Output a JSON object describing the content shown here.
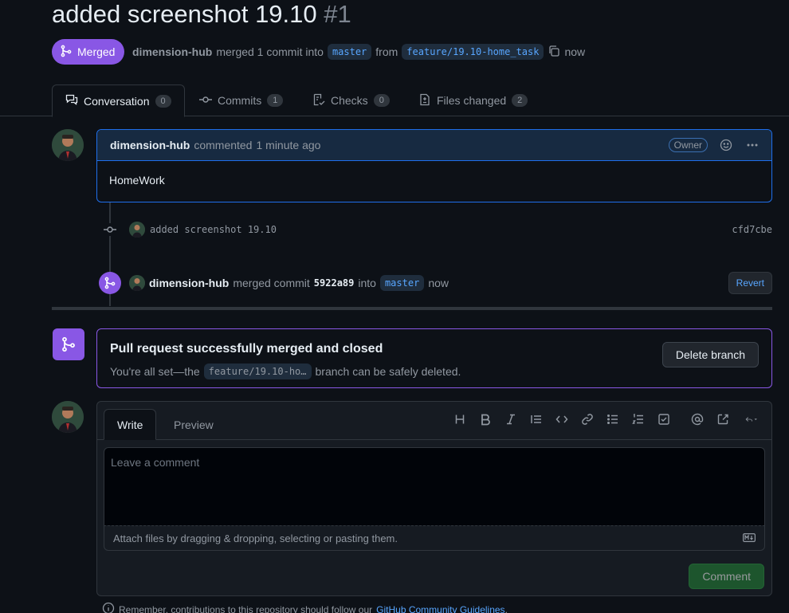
{
  "pr": {
    "title": "added screenshot 19.10",
    "number": "#1",
    "state_label": "Merged",
    "author": "dimension-hub",
    "merged_text": "merged 1 commit into",
    "base_branch": "master",
    "from_text": "from",
    "head_branch": "feature/19.10-home_task",
    "time": "now"
  },
  "tabs": [
    {
      "label": "Conversation",
      "count": "0",
      "icon": "comment-discussion-icon"
    },
    {
      "label": "Commits",
      "count": "1",
      "icon": "git-commit-icon"
    },
    {
      "label": "Checks",
      "count": "0",
      "icon": "checklist-icon"
    },
    {
      "label": "Files changed",
      "count": "2",
      "icon": "file-diff-icon"
    }
  ],
  "comment": {
    "author": "dimension-hub",
    "action": "commented",
    "time": "1 minute ago",
    "role": "Owner",
    "body": "HomeWork"
  },
  "commit": {
    "message": "added screenshot 19.10",
    "sha": "cfd7cbe"
  },
  "merge_event": {
    "author": "dimension-hub",
    "action": "merged commit",
    "sha": "5922a89",
    "into": "into",
    "branch": "master",
    "time": "now",
    "revert_label": "Revert"
  },
  "merged_box": {
    "title": "Pull request successfully merged and closed",
    "sub_pre": "You're all set—the",
    "branch": "feature/19.10-ho…",
    "sub_post": "branch can be safely deleted.",
    "delete_label": "Delete branch"
  },
  "editor": {
    "tab_write": "Write",
    "tab_preview": "Preview",
    "placeholder": "Leave a comment",
    "attach_text": "Attach files by dragging & dropping, selecting or pasting them.",
    "submit_label": "Comment"
  },
  "footer": {
    "text": "Remember, contributions to this repository should follow our",
    "link": "GitHub Community Guidelines",
    "period": "."
  },
  "colors": {
    "merged_purple": "#8957e5",
    "accent_blue": "#58a6ff",
    "success_green": "#238636",
    "background": "#0d1117"
  }
}
